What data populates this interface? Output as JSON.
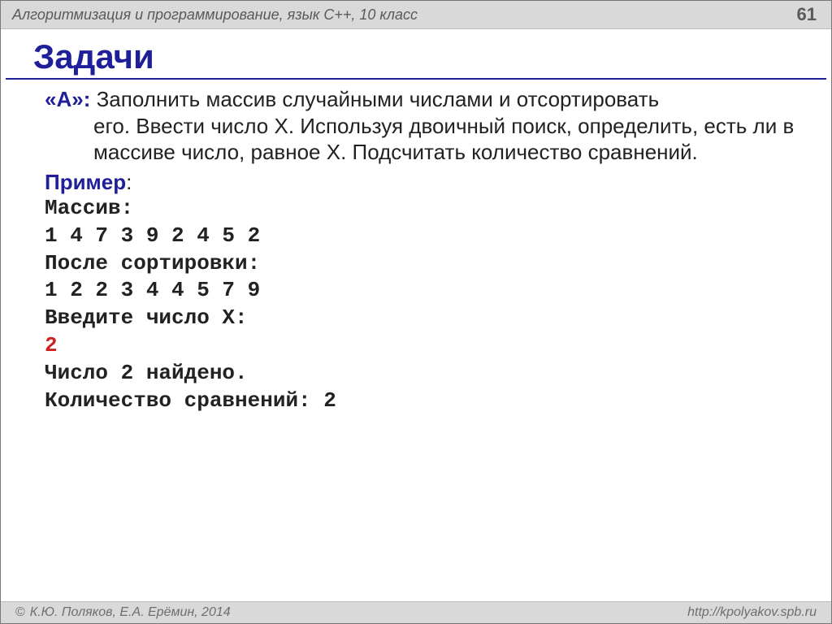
{
  "header": {
    "course": "Алгоритмизация и программирование, язык C++, 10 класс",
    "page": "61"
  },
  "title": "Задачи",
  "task": {
    "label": "«A»:",
    "text_line1": "Заполнить массив случайными числами и отсортировать",
    "text_rest": "его.  Ввести число X. Используя двоичный поиск, определить, есть ли в массиве число, равное X. Подсчитать количество сравнений."
  },
  "example_label": "Пример",
  "example_colon": ":",
  "mono": {
    "l1": "Массив:",
    "l2": "1 4 7 3 9 2 4 5 2",
    "l3": "После сортировки:",
    "l4": "1 2 2 3 4 4 5 7 9",
    "l5": "Введите число X:",
    "l6": "2",
    "l7": "Число 2 найдено.",
    "l8": "Количество сравнений: 2"
  },
  "footer": {
    "copy": "К.Ю. Поляков, Е.А. Ерёмин, 2014",
    "copy_symbol": "©",
    "url": "http://kpolyakov.spb.ru"
  }
}
